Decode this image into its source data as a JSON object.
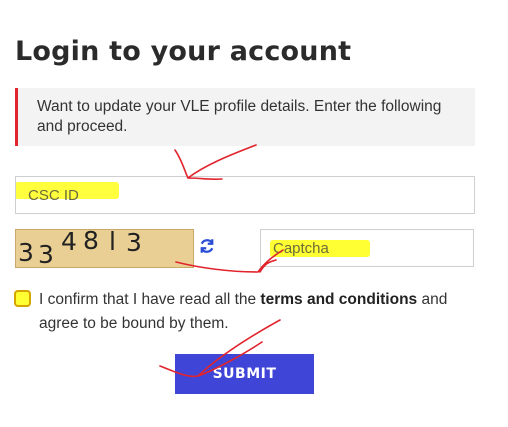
{
  "page": {
    "title": "Login to your account"
  },
  "notice": {
    "text": "Want to update your VLE profile details. Enter the following and proceed."
  },
  "form": {
    "csc_id_placeholder": "CSC ID",
    "captcha_placeholder": "Captcha",
    "captcha_image_text": [
      "3",
      "3",
      "4",
      "8",
      "l",
      "3"
    ],
    "refresh_icon": "refresh-icon",
    "confirm_text_before": "I confirm that I have read all the ",
    "terms_label": "terms and conditions",
    "confirm_text_after": " and agree to be bound by them.",
    "submit_label": "SUBMIT"
  },
  "colors": {
    "accent_red": "#e1242d",
    "submit_blue": "#3f45d6",
    "highlight_yellow": "#ffff33",
    "captcha_bg": "#e9cf93"
  }
}
